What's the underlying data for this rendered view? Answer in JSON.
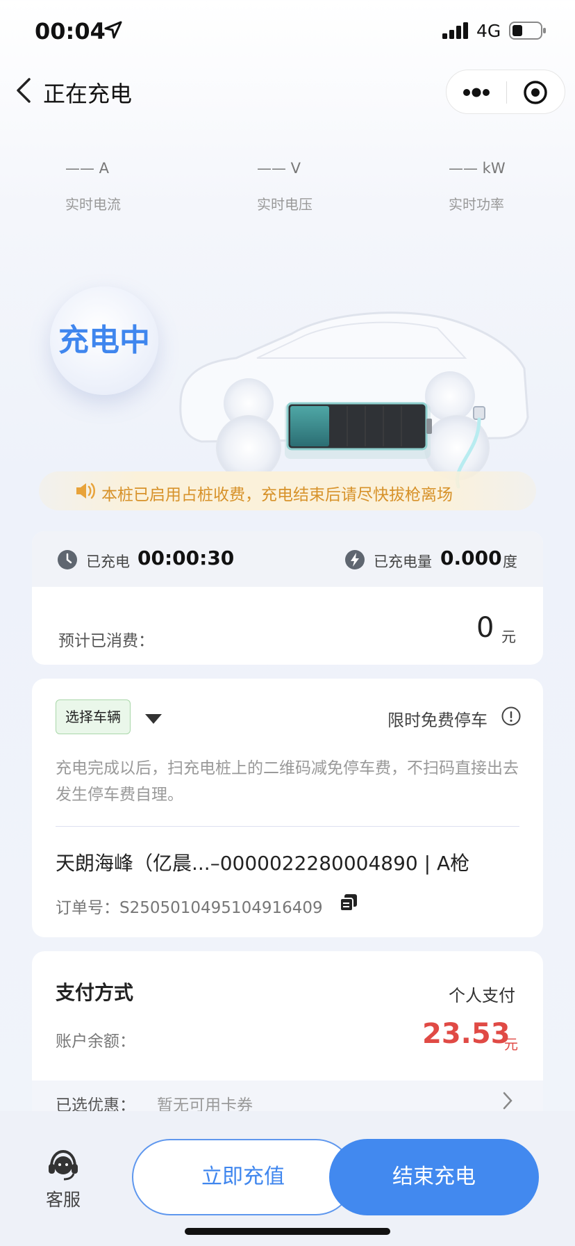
{
  "status_bar": {
    "time": "00:04",
    "network": "4G"
  },
  "nav": {
    "title": "正在充电"
  },
  "metrics": [
    {
      "value": "—— A",
      "label": "实时电流"
    },
    {
      "value": "—— V",
      "label": "实时电压"
    },
    {
      "value": "—— kW",
      "label": "实时功率"
    }
  ],
  "charging_status": "充电中",
  "notice": "本桩已启用占桩收费，充电结束后请尽快拔枪离场",
  "charge": {
    "time_label": "已充电",
    "time_value": "00:00:30",
    "energy_label": "已充电量",
    "energy_value": "0.000",
    "energy_unit": "度",
    "cost_label": "预计已消费：",
    "cost_value": "0",
    "cost_unit": "元"
  },
  "vehicle": {
    "select_label": "选择车辆",
    "parking_label": "限时免费停车",
    "parking_desc": "充电完成以后，扫充电桩上的二维码减免停车费，不扫码直接出去发生停车费自理。",
    "station_name": "天朗海峰（亿晨...–0000022280004890 | A枪",
    "order_label": "订单号：S2505010495104916409"
  },
  "payment": {
    "title": "支付方式",
    "method": "个人支付",
    "balance_label": "账户余额：",
    "balance_value": "23.53",
    "balance_unit": "元",
    "coupon_label": "已选优惠：",
    "coupon_value": "暂无可用卡券"
  },
  "bottom": {
    "service_label": "客服",
    "recharge_label": "立即充值",
    "stop_label": "结束充电"
  },
  "colors": {
    "accent": "#3f86ee",
    "balance": "#e04a45",
    "notice": "#d7922a"
  }
}
